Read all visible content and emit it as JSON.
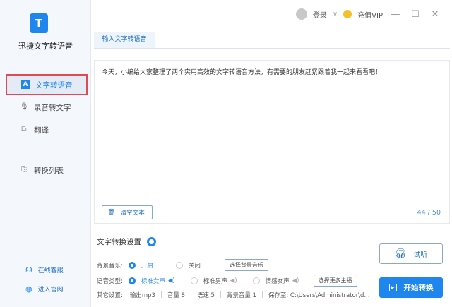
{
  "app": {
    "name": "迅捷文字转语音",
    "logo_letter": "T"
  },
  "sidebar": {
    "items": [
      {
        "label": "文字转语音",
        "icon": "A"
      },
      {
        "label": "录音转文字",
        "icon": "mic-icon"
      },
      {
        "label": "翻译",
        "icon": "translate-icon"
      },
      {
        "label": "转换列表",
        "icon": "list-icon"
      }
    ],
    "bottom": [
      {
        "label": "在线客服"
      },
      {
        "label": "进入官网"
      }
    ]
  },
  "topbar": {
    "login": "登录",
    "vip": "充值VIP"
  },
  "tab": {
    "label": "输入文字转语音"
  },
  "editor": {
    "text": "今天，小编给大家整理了两个实用高效的文字转语音方法，有需要的朋友赶紧跟着我一起来看看吧！",
    "clear_label": "清空文本",
    "count": "44 / 50"
  },
  "settings": {
    "title": "文字转换设置",
    "bg_music": {
      "label": "背景音乐:",
      "on": "开启",
      "off": "关闭",
      "button": "选择背景音乐"
    },
    "voice": {
      "label": "语音类型:",
      "options": [
        "标准女声",
        "标准男声",
        "情感女声"
      ],
      "button": "选择更多主播"
    },
    "other": {
      "label": "其它设置:",
      "items": [
        "输出mp3",
        "音量 8",
        "语速 5",
        "背景音量 1",
        "保存至: C:\\Users\\Administrator\\d..."
      ]
    }
  },
  "actions": {
    "listen": "试听",
    "start": "开始转换"
  }
}
